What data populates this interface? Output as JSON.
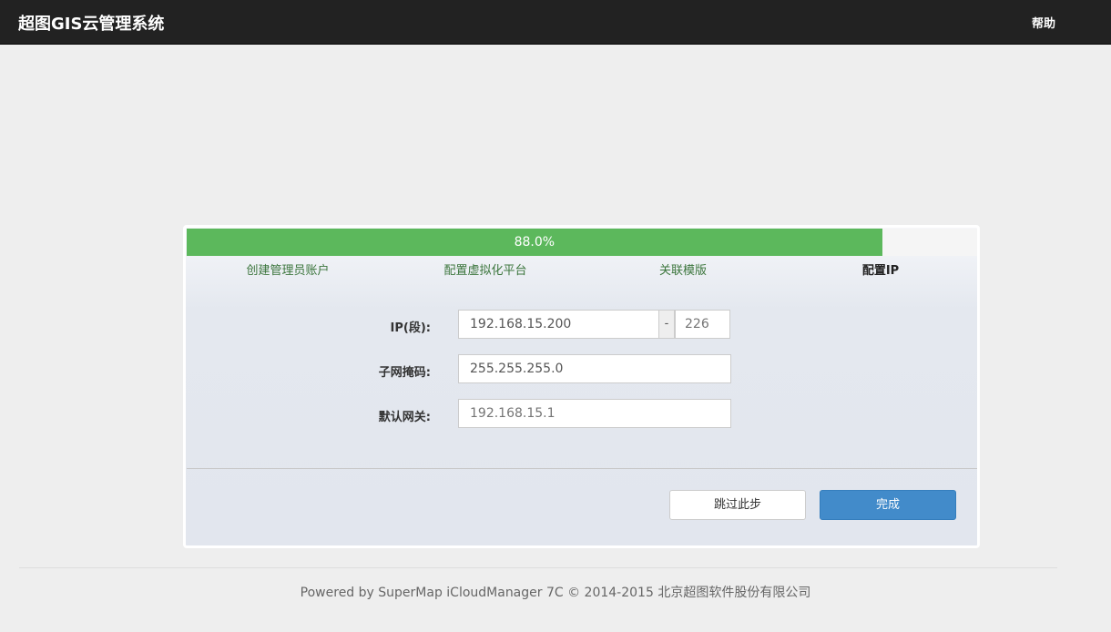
{
  "navbar": {
    "brand": "超图GIS云管理系统",
    "help_label": "帮助"
  },
  "progress": {
    "percent": 88.0,
    "label": "88.0%",
    "bar_color": "#5cb85c"
  },
  "steps": [
    {
      "label": "创建管理员账户",
      "state": "done"
    },
    {
      "label": "配置虚拟化平台",
      "state": "done"
    },
    {
      "label": "关联模版",
      "state": "done"
    },
    {
      "label": "配置IP",
      "state": "active"
    }
  ],
  "form": {
    "ip_label": "IP(段):",
    "ip_start_value": "192.168.15.200",
    "ip_separator": "-",
    "ip_end_placeholder": "226",
    "mask_label": "子网掩码:",
    "mask_value": "255.255.255.0",
    "gateway_label": "默认网关:",
    "gateway_placeholder": "192.168.15.1"
  },
  "buttons": {
    "skip_label": "跳过此步",
    "finish_label": "完成",
    "primary_color": "#428bca"
  },
  "footer": {
    "text": "Powered by SuperMap iCloudManager 7C © 2014-2015 北京超图软件股份有限公司"
  }
}
